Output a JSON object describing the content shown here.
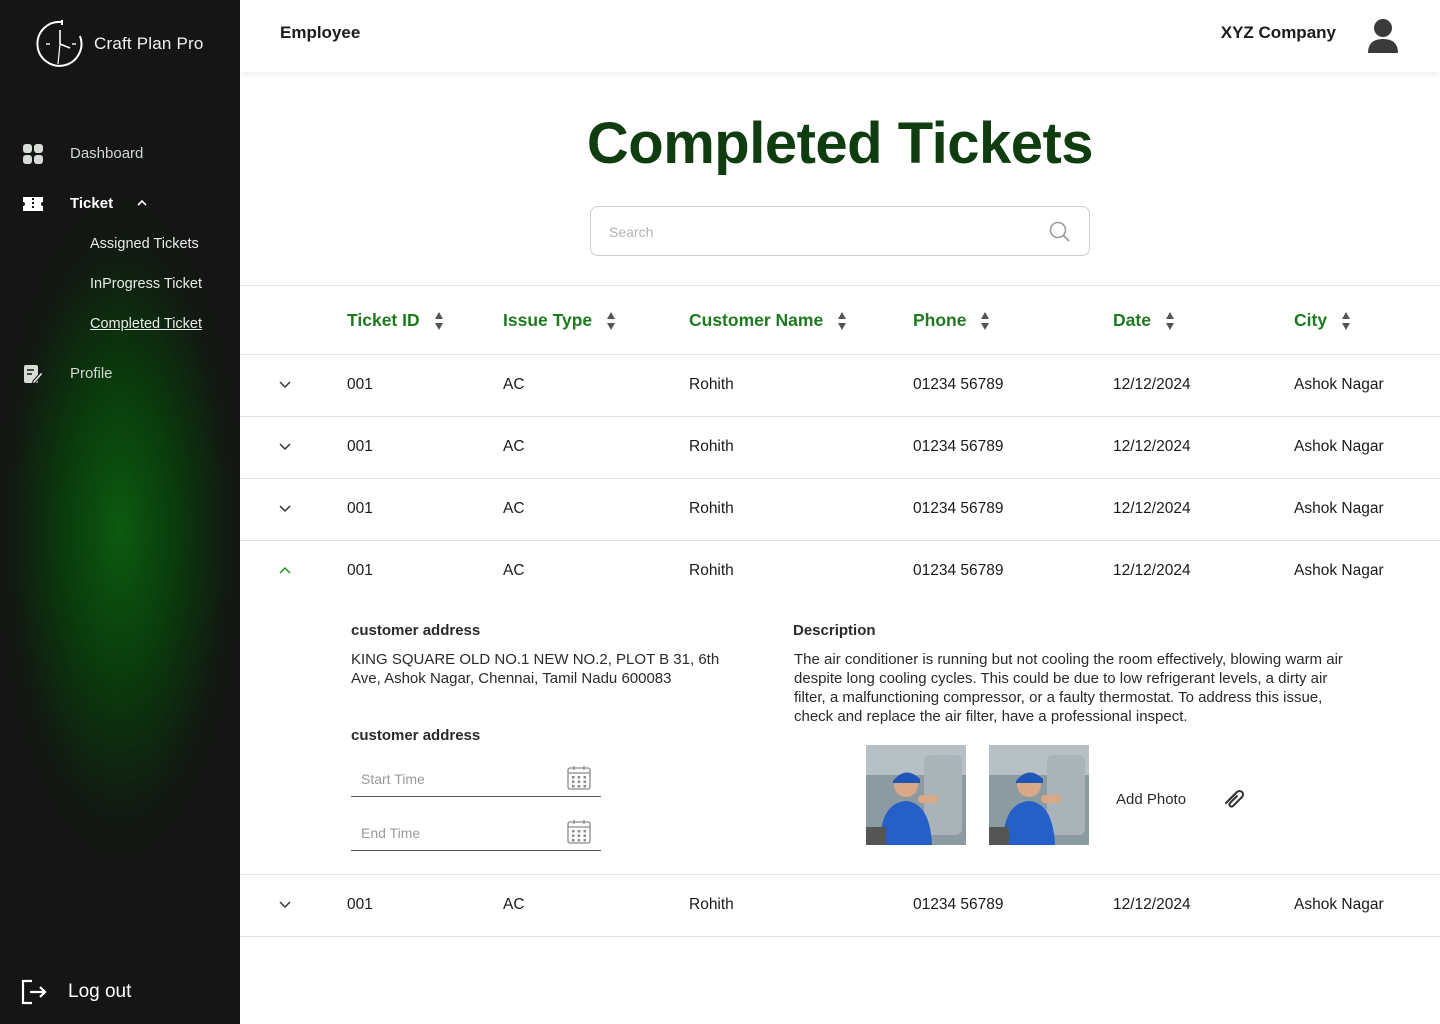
{
  "app": {
    "brand": "Craft Plan Pro"
  },
  "sidebar": {
    "items": [
      {
        "label": "Dashboard",
        "icon": "dashboard-icon"
      },
      {
        "label": "Ticket",
        "icon": "ticket-icon",
        "expanded": true,
        "children": [
          "Assigned Tickets",
          "InProgress Ticket",
          "Completed Ticket"
        ]
      },
      {
        "label": "Profile",
        "icon": "profile-edit-icon"
      }
    ],
    "logout": "Log out"
  },
  "topbar": {
    "title": "Employee",
    "company": "XYZ Company",
    "avatar_icon": "user-avatar-icon"
  },
  "main": {
    "title": "Completed Tickets",
    "search_placeholder": "Search",
    "columns": [
      "Ticket ID",
      "Issue Type",
      "Customer Name",
      "Phone",
      "Date",
      "City"
    ],
    "rows": [
      {
        "id": "001",
        "issue": "AC",
        "customer": "Rohith",
        "phone": "01234 56789",
        "date": "12/12/2024",
        "city": "Ashok Nagar",
        "expanded": false
      },
      {
        "id": "001",
        "issue": "AC",
        "customer": "Rohith",
        "phone": "01234 56789",
        "date": "12/12/2024",
        "city": "Ashok Nagar",
        "expanded": false
      },
      {
        "id": "001",
        "issue": "AC",
        "customer": "Rohith",
        "phone": "01234 56789",
        "date": "12/12/2024",
        "city": "Ashok Nagar",
        "expanded": false
      },
      {
        "id": "001",
        "issue": "AC",
        "customer": "Rohith",
        "phone": "01234 56789",
        "date": "12/12/2024",
        "city": "Ashok Nagar",
        "expanded": true
      },
      {
        "id": "001",
        "issue": "AC",
        "customer": "Rohith",
        "phone": "01234 56789",
        "date": "12/12/2024",
        "city": "Ashok Nagar",
        "expanded": false
      }
    ],
    "detail": {
      "address_label": "customer address",
      "address_line1": "KING SQUARE OLD NO.1 NEW NO.2, PLOT B 31, 6th",
      "address_line2": "Ave, Ashok Nagar, Chennai, Tamil Nadu 600083",
      "time_label": "customer address",
      "start_placeholder": "Start Time",
      "end_placeholder": "End Time",
      "description_label": "Description",
      "description_lines": [
        "The air conditioner is running but not cooling the room effectively, blowing warm air",
        "despite long cooling cycles. This could be due to low refrigerant levels, a dirty air",
        "filter, a malfunctioning compressor, or a faulty thermostat. To address this issue,",
        "check and replace the air filter, have a professional inspect."
      ],
      "add_photo": "Add Photo"
    }
  },
  "colors": {
    "accent": "#1f7a1f",
    "title": "#0f3d0f",
    "sidebar_bg": "#151515"
  }
}
